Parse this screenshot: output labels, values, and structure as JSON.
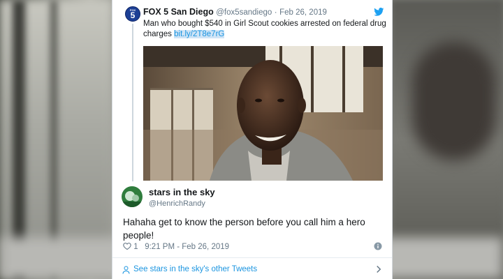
{
  "quoted_tweet": {
    "name": "FOX 5 San Diego",
    "handle": "@fox5sandiego",
    "separator": "·",
    "date": "Feb 26, 2019",
    "text": "Man who bought $540 in Girl Scout cookies arrested on federal drug charges",
    "link": "bit.ly/2T8e7rG",
    "logo_text": "FOX",
    "logo_number": "5"
  },
  "reply_tweet": {
    "name": "stars in the sky",
    "handle": "@HenrichRandy",
    "text": "Hahaha get to know the person before you call him a hero people!",
    "like_count": "1",
    "timestamp": "9:21 PM - Feb 26, 2019"
  },
  "footer": {
    "see_tweets_label": "See stars in the sky's other Tweets"
  },
  "colors": {
    "link_blue": "#1b95e0",
    "text_dark": "#14171a",
    "text_gray": "#657786"
  },
  "icons": [
    "twitter-bird-icon",
    "heart-icon",
    "info-icon",
    "person-icon",
    "chevron-right-icon"
  ]
}
